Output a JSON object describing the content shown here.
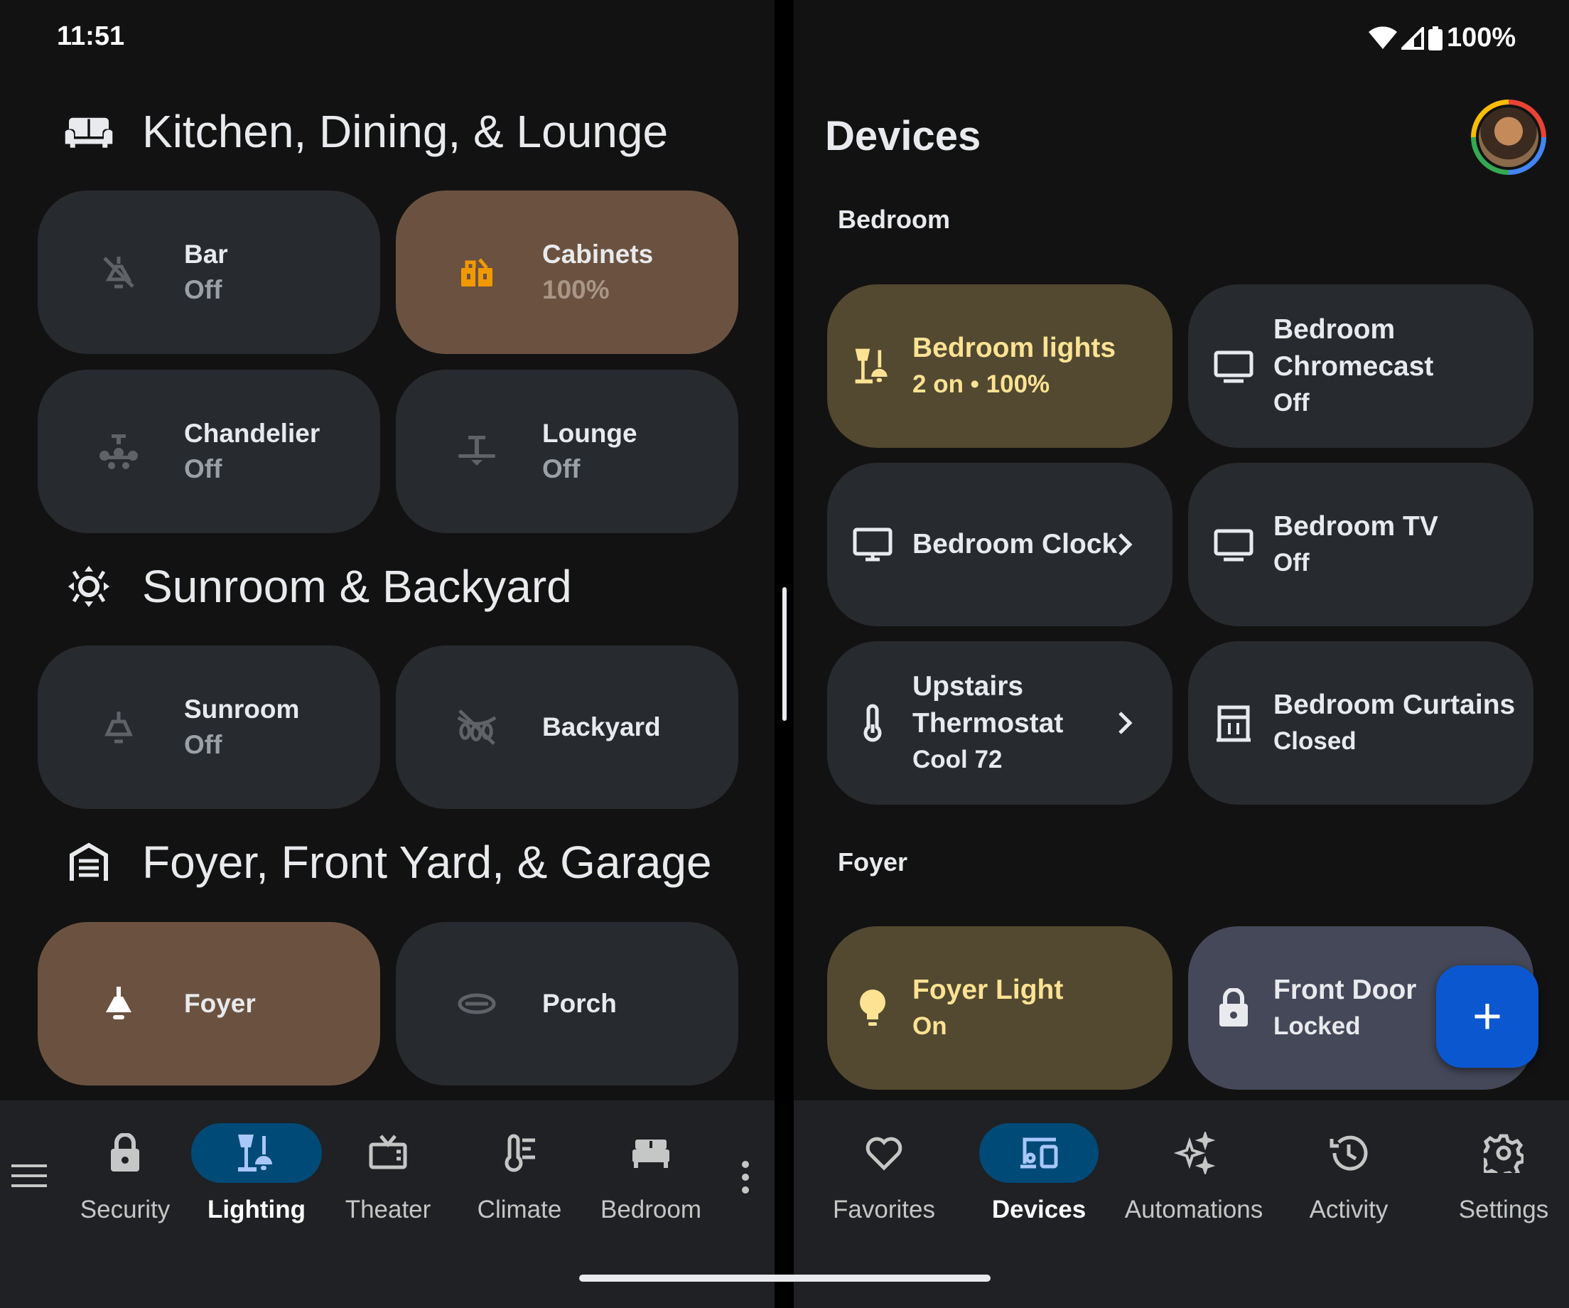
{
  "status_bar": {
    "time": "11:51",
    "battery": "100%"
  },
  "left": {
    "sections": [
      {
        "title": "Kitchen, Dining, & Lounge",
        "icon": "sofa-icon"
      },
      {
        "title": "Sunroom & Backyard",
        "icon": "sun-icon"
      },
      {
        "title": "Foyer, Front Yard, & Garage",
        "icon": "garage-icon"
      }
    ],
    "tiles": [
      {
        "name": "Bar",
        "state": "Off",
        "icon": "pendant-light-icon"
      },
      {
        "name": "Cabinets",
        "state": "100%",
        "icon": "cabinet-light-icon"
      },
      {
        "name": "Chandelier",
        "state": "Off",
        "icon": "chandelier-icon"
      },
      {
        "name": "Lounge",
        "state": "Off",
        "icon": "ceiling-fan-light-icon"
      },
      {
        "name": "Sunroom",
        "state": "Off",
        "icon": "ceiling-light-icon"
      },
      {
        "name": "Backyard",
        "state": "",
        "icon": "string-lights-off-icon"
      },
      {
        "name": "Foyer",
        "state": "",
        "icon": "pendant-light-icon"
      },
      {
        "name": "Porch",
        "state": "",
        "icon": "flush-mount-light-icon"
      }
    ],
    "nav": [
      {
        "label": "Security",
        "icon": "lock-icon"
      },
      {
        "label": "Lighting",
        "icon": "lighting-icon"
      },
      {
        "label": "Theater",
        "icon": "tv-icon"
      },
      {
        "label": "Climate",
        "icon": "thermometer-icon"
      },
      {
        "label": "Bedroom",
        "icon": "bed-icon"
      }
    ]
  },
  "right": {
    "title": "Devices",
    "rooms": [
      "Bedroom",
      "Foyer"
    ],
    "tiles": [
      {
        "name": "Bedroom lights",
        "state": "2 on • 100%",
        "icon": "lamps-icon"
      },
      {
        "name": "Bedroom Chromecast",
        "state": "Off",
        "icon": "display-icon"
      },
      {
        "name": "Bedroom Clock",
        "state": "",
        "icon": "monitor-icon"
      },
      {
        "name": "Bedroom TV",
        "state": "Off",
        "icon": "display-icon"
      },
      {
        "name": "Upstairs Thermostat",
        "state": "Cool 72",
        "icon": "thermometer-icon"
      },
      {
        "name": "Bedroom Curtains",
        "state": "Closed",
        "icon": "curtains-icon"
      },
      {
        "name": "Foyer Light",
        "state": "On",
        "icon": "bulb-icon"
      },
      {
        "name": "Front Door",
        "state": "Locked",
        "icon": "lock-icon"
      }
    ],
    "fab": "+",
    "nav": [
      {
        "label": "Favorites",
        "icon": "heart-icon"
      },
      {
        "label": "Devices",
        "icon": "devices-icon"
      },
      {
        "label": "Automations",
        "icon": "sparkle-icon"
      },
      {
        "label": "Activity",
        "icon": "history-icon"
      },
      {
        "label": "Settings",
        "icon": "gear-icon"
      }
    ]
  },
  "colors": {
    "tile": "#272a2e",
    "tile_warm_on": "#6b5240",
    "tile_yellow_on": "#524930",
    "tile_locked": "#444859",
    "accent_yellow": "#fde293",
    "nav_active": "#004a77",
    "fab": "#0b57d0"
  }
}
